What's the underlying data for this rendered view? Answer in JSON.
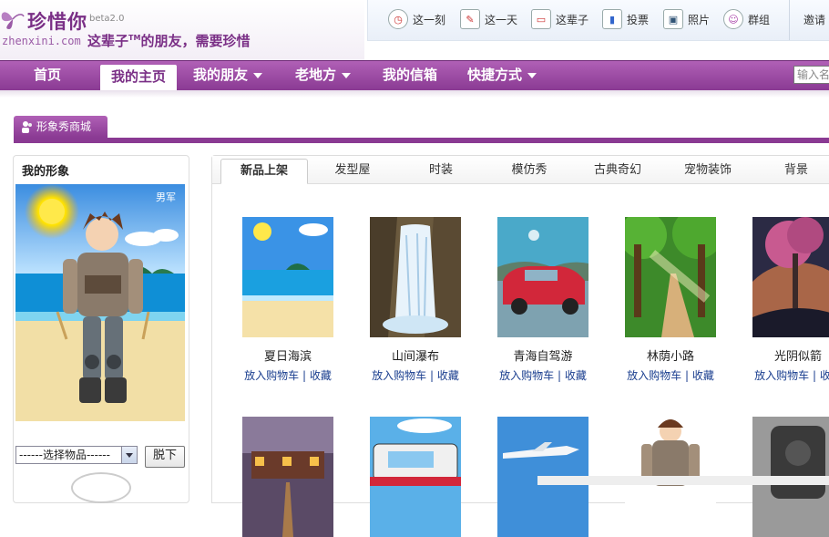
{
  "header": {
    "logo_name": "珍惜你",
    "logo_beta": "beta2.0",
    "logo_url": "zhenxini.com",
    "slogan_pre": "这辈子",
    "slogan_tm": "TM",
    "slogan_post": "的朋友，需要珍惜",
    "top_links": [
      {
        "label": "这一刻",
        "icon": "clock-icon"
      },
      {
        "label": "这一天",
        "icon": "notepad-icon"
      },
      {
        "label": "这辈子",
        "icon": "chat-bubble-icon"
      },
      {
        "label": "投票",
        "icon": "bar-chart-icon"
      },
      {
        "label": "照片",
        "icon": "photo-frame-icon"
      },
      {
        "label": "群组",
        "icon": "group-icon"
      }
    ],
    "invite_label": "邀请"
  },
  "nav": {
    "items": [
      {
        "label": "首页"
      },
      {
        "label": "我的主页"
      },
      {
        "label": "我的朋友"
      },
      {
        "label": "老地方"
      },
      {
        "label": "我的信箱"
      },
      {
        "label": "快捷方式"
      }
    ],
    "search_placeholder": "输入名"
  },
  "shop_tab": {
    "label": "形象秀商城"
  },
  "left": {
    "title": "我的形象",
    "gender": "男军",
    "select_value": "------选择物品------",
    "undress_label": "脱下"
  },
  "tabs": [
    "新品上架",
    "发型屋",
    "时装",
    "模仿秀",
    "古典奇幻",
    "宠物装饰",
    "背景"
  ],
  "items_row1": [
    {
      "name": "夏日海滨",
      "cart": "放入购物车",
      "sep": " | ",
      "fav": "收藏"
    },
    {
      "name": "山间瀑布",
      "cart": "放入购物车",
      "sep": " | ",
      "fav": "收藏"
    },
    {
      "name": "青海自驾游",
      "cart": "放入购物车",
      "sep": " | ",
      "fav": "收藏"
    },
    {
      "name": "林荫小路",
      "cart": "放入购物车",
      "sep": " | ",
      "fav": "收藏"
    },
    {
      "name": "光阴似箭",
      "cart": "放入购物车",
      "sep": " | ",
      "fav": "收藏"
    }
  ],
  "colors": {
    "brand": "#8a3a93",
    "link": "#1a3e8f"
  }
}
